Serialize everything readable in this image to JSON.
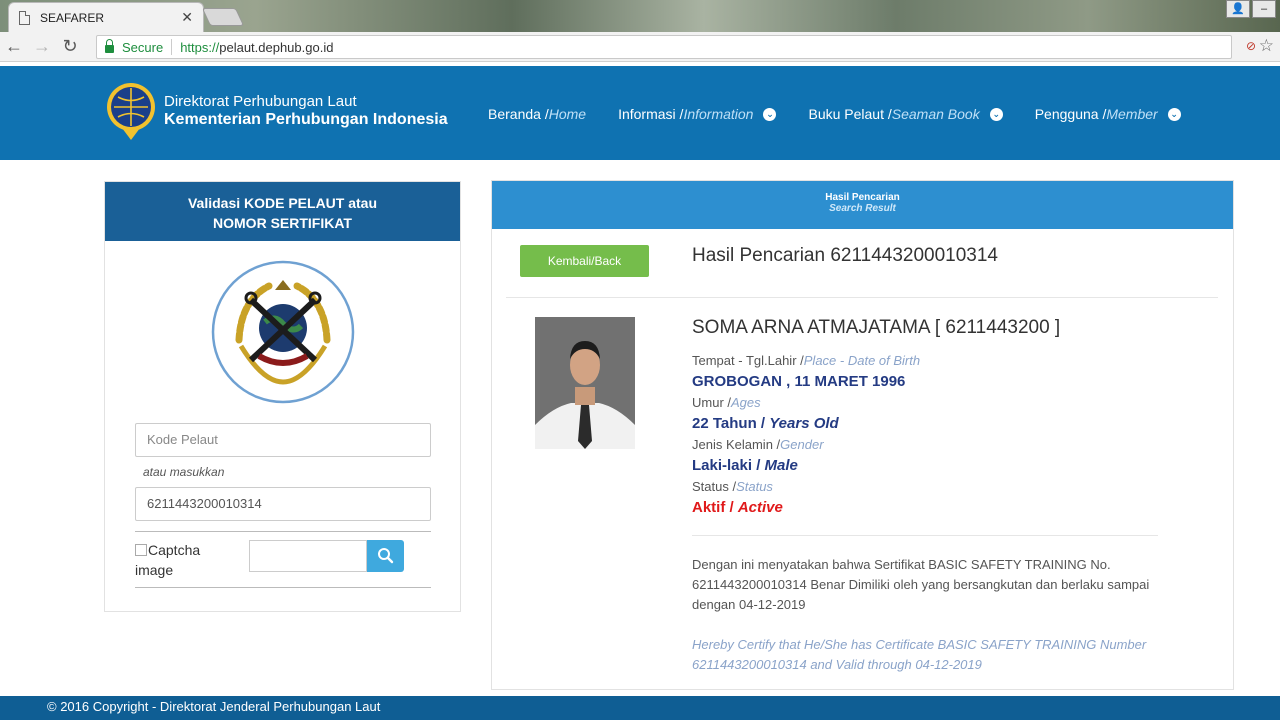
{
  "browser": {
    "tab_title": "SEAFARER",
    "tab_close": "✕",
    "secure_label": "Secure",
    "url_scheme": "https://",
    "url_host": "pelaut.dephub.go.id"
  },
  "header": {
    "org_line1": "Direktorat Perhubungan Laut",
    "org_line2": "Kementerian Perhubungan Indonesia",
    "nav": [
      {
        "label": "Beranda / ",
        "en": "Home",
        "dropdown": false
      },
      {
        "label": "Informasi / ",
        "en": "Information",
        "dropdown": true
      },
      {
        "label": "Buku Pelaut / ",
        "en": "Seaman Book",
        "dropdown": true
      },
      {
        "label": "Pengguna / ",
        "en": "Member",
        "dropdown": true
      }
    ]
  },
  "left": {
    "title_line1": "Validasi KODE PELAUT atau",
    "title_line2": "NOMOR SERTIFIKAT",
    "kode_placeholder": "Kode Pelaut",
    "hint": "atau masukkan",
    "cert_value": "6211443200010314",
    "captcha_alt_line1": "Captcha",
    "captcha_alt_line2": "image"
  },
  "result": {
    "head_title": "Hasil Pencarian",
    "head_subtitle": "Search Result",
    "back_label": "Kembali/Back",
    "title": "Hasil Pencarian 6211443200010314",
    "name": "SOMA ARNA ATMAJATAMA [ 6211443200 ]",
    "fields": [
      {
        "label": "Tempat - Tgl.Lahir /",
        "label_en": "Place - Date of Birth",
        "value": "GROBOGAN , 11 MARET 1996",
        "value_en": ""
      },
      {
        "label": "Umur /",
        "label_en": "Ages",
        "value": "22 Tahun / ",
        "value_en": "Years Old"
      },
      {
        "label": "Jenis Kelamin /",
        "label_en": "Gender",
        "value": "Laki-laki / ",
        "value_en": "Male"
      },
      {
        "label": "Status /",
        "label_en": "Status",
        "value": "Aktif / ",
        "value_en": "Active"
      }
    ],
    "cert_id": "Dengan ini menyatakan bahwa Sertifikat BASIC SAFETY TRAINING No. 6211443200010314 Benar Dimiliki oleh yang bersangkutan dan berlaku sampai dengan 04-12-2019",
    "cert_en": "Hereby Certify that He/She has Certificate BASIC SAFETY TRAINING Number 6211443200010314 and Valid through 04-12-2019"
  },
  "footer": {
    "text": "© 2016  Copyright - Direktorat Jenderal Perhubungan Laut"
  },
  "colors": {
    "header_blue": "#0f72b1",
    "panel_head": "#1a6097",
    "result_head": "#2d8fd0",
    "back_green": "#75bd4b",
    "value_navy": "#243b83",
    "active_red": "#e0191a"
  }
}
